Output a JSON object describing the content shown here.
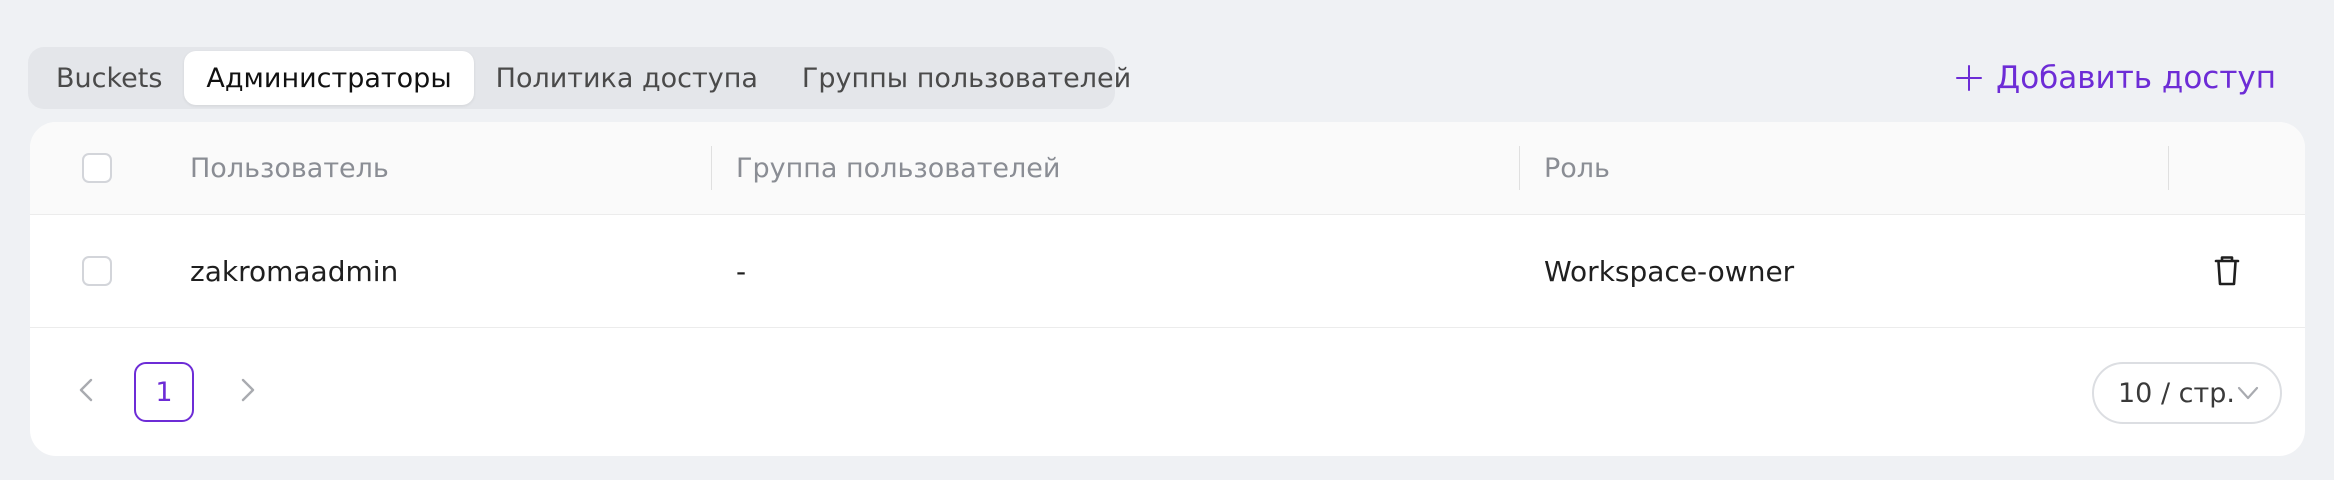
{
  "tabs": [
    {
      "label": "Buckets",
      "active": false
    },
    {
      "label": "Администраторы",
      "active": true
    },
    {
      "label": "Политика доступа",
      "active": false
    },
    {
      "label": "Группы пользователей",
      "active": false
    }
  ],
  "actions": {
    "add_access_label": "Добавить доступ",
    "add_access_icon": "plus-icon"
  },
  "table": {
    "columns": [
      "Пользователь",
      "Группа пользователей",
      "Роль"
    ],
    "rows": [
      {
        "user": "zakromaadmin",
        "group": "-",
        "role": "Workspace-owner",
        "action_icon": "trash-icon"
      }
    ]
  },
  "pagination": {
    "current_page": "1",
    "page_size": "10 / стр.",
    "prev_icon": "chevron-left-icon",
    "next_icon": "chevron-right-icon"
  },
  "colors": {
    "accent": "#6d2cd6",
    "background": "#eff1f4",
    "card": "#ffffff",
    "header_text": "#8a8d94"
  }
}
